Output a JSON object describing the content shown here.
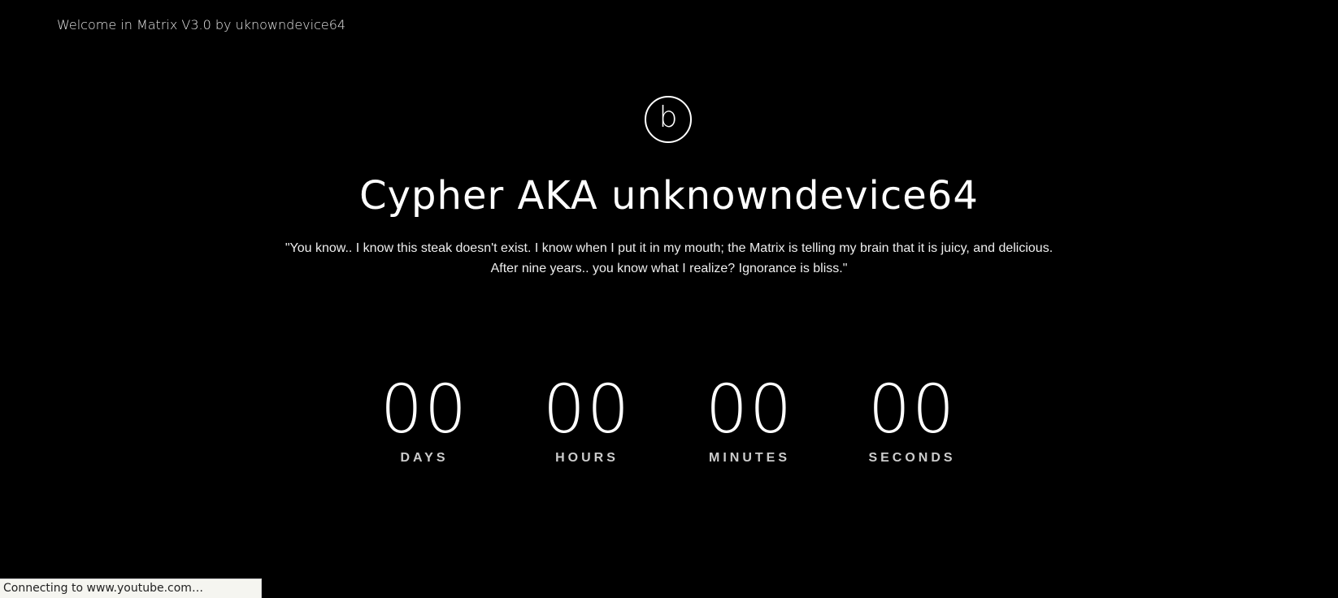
{
  "header": {
    "welcome_text": "Welcome in Matrix V3.0 by uknowndevice64"
  },
  "logo": {
    "letter": "b",
    "icon": "circle-letter-logo"
  },
  "hero": {
    "title": "Cypher AKA unknowndevice64",
    "quote_line1": "\"You know.. I know this steak doesn't exist. I know when I put it in my mouth; the Matrix is telling my brain that it is juicy, and delicious.",
    "quote_line2": "After nine years.. you know what I realize? Ignorance is bliss.\""
  },
  "countdown": {
    "days": {
      "value": "00",
      "label": "DAYS"
    },
    "hours": {
      "value": "00",
      "label": "HOURS"
    },
    "minutes": {
      "value": "00",
      "label": "MINUTES"
    },
    "seconds": {
      "value": "00",
      "label": "SECONDS"
    }
  },
  "statusbar": {
    "text": "Connecting to www.youtube.com…"
  },
  "colors": {
    "background": "#000000",
    "text": "#ffffff",
    "label": "#cccccc",
    "statusbar_bg": "#f5f5f0"
  }
}
